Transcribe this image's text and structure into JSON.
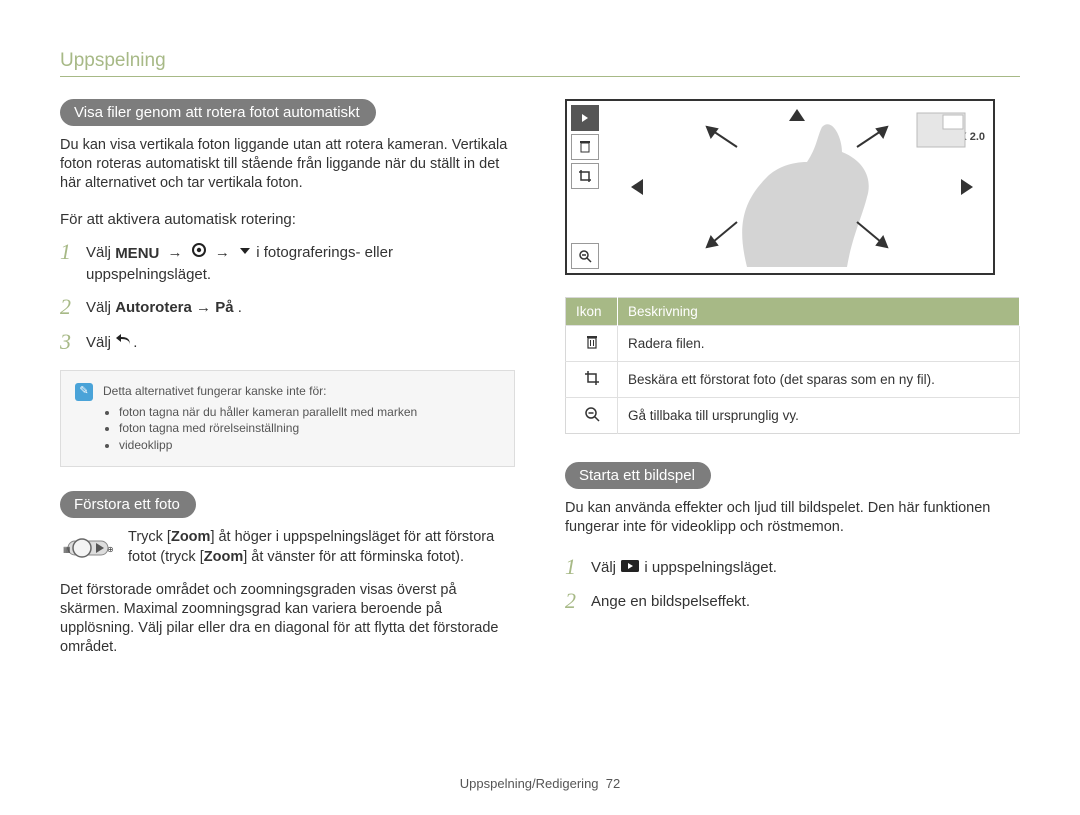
{
  "header": {
    "section": "Uppspelning"
  },
  "left": {
    "heading1": "Visa ﬁler genom att rotera fotot automatiskt",
    "body1": "Du kan visa vertikala foton liggande utan att rotera kameran. Vertikala foton roteras automatiskt till stående från liggande när du ställt in det här alternativet och tar vertikala foton.",
    "sub1": "För att aktivera automatisk rotering:",
    "step1_pre": "Välj ",
    "step1_post": " i fotograferings- eller uppspelningsläget.",
    "step2_a": "Välj ",
    "step2_b": "Autorotera",
    "step2_c": " → ",
    "step2_d": "På",
    "step2_e": ".",
    "step3": "Välj ",
    "note_title": "Detta alternativet fungerar kanske inte för:",
    "note_items": [
      "foton tagna när du håller kameran parallellt med marken",
      "foton tagna med rörelseinställning",
      "videoklipp"
    ],
    "heading2": "Förstora ett foto",
    "zoom_a": "Tryck [",
    "zoom_b": "Zoom",
    "zoom_c": "] åt höger i uppspelningsläget för att förstora fotot (tryck [",
    "zoom_d": "Zoom",
    "zoom_e": "] åt vänster för att förminska fotot).",
    "body2": "Det förstorade området och zoomningsgraden visas överst på skärmen. Maximal zoomningsgrad kan variera beroende på upplösning. Välj pilar eller dra en diagonal för att ﬂytta det förstorade området."
  },
  "right": {
    "zoom_label": "X 2.0",
    "table": {
      "headers": [
        "Ikon",
        "Beskrivning"
      ],
      "rows": [
        {
          "icon": "trash",
          "desc": "Radera ﬁlen."
        },
        {
          "icon": "crop",
          "desc": "Beskära ett förstorat foto (det sparas som en ny ﬁl)."
        },
        {
          "icon": "zoomout",
          "desc": "Gå tillbaka till ursprunglig vy."
        }
      ]
    },
    "heading3": "Starta ett bildspel",
    "body3": "Du kan använda effekter och ljud till bildspelet. Den här funktionen fungerar inte för videoklipp och röstmemon.",
    "step1": "Välj ",
    "step1_post": " i uppspelningsläget.",
    "step2": "Ange en bildspelseffekt."
  },
  "footer": {
    "text": "Uppspelning/Redigering",
    "page": "72"
  }
}
